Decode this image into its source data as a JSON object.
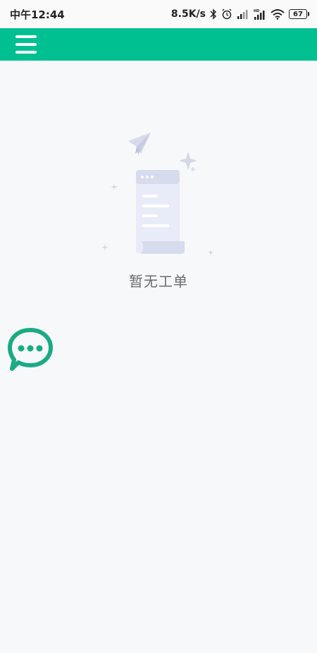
{
  "status_bar": {
    "time": "中午12:44",
    "network_speed": "8.5K/s",
    "battery": "67",
    "icons": [
      "bluetooth-icon",
      "alarm-icon",
      "signal-icon",
      "hd-signal-icon",
      "wifi-icon",
      "battery-icon"
    ]
  },
  "app_bar": {
    "color": "#00c091",
    "menu_icon": "hamburger-menu-icon"
  },
  "empty_state": {
    "illustration": "empty-document-illustration",
    "message": "暂无工单"
  },
  "floating": {
    "chat_icon": "chat-bubble-icon",
    "chat_color": "#1aab84"
  }
}
